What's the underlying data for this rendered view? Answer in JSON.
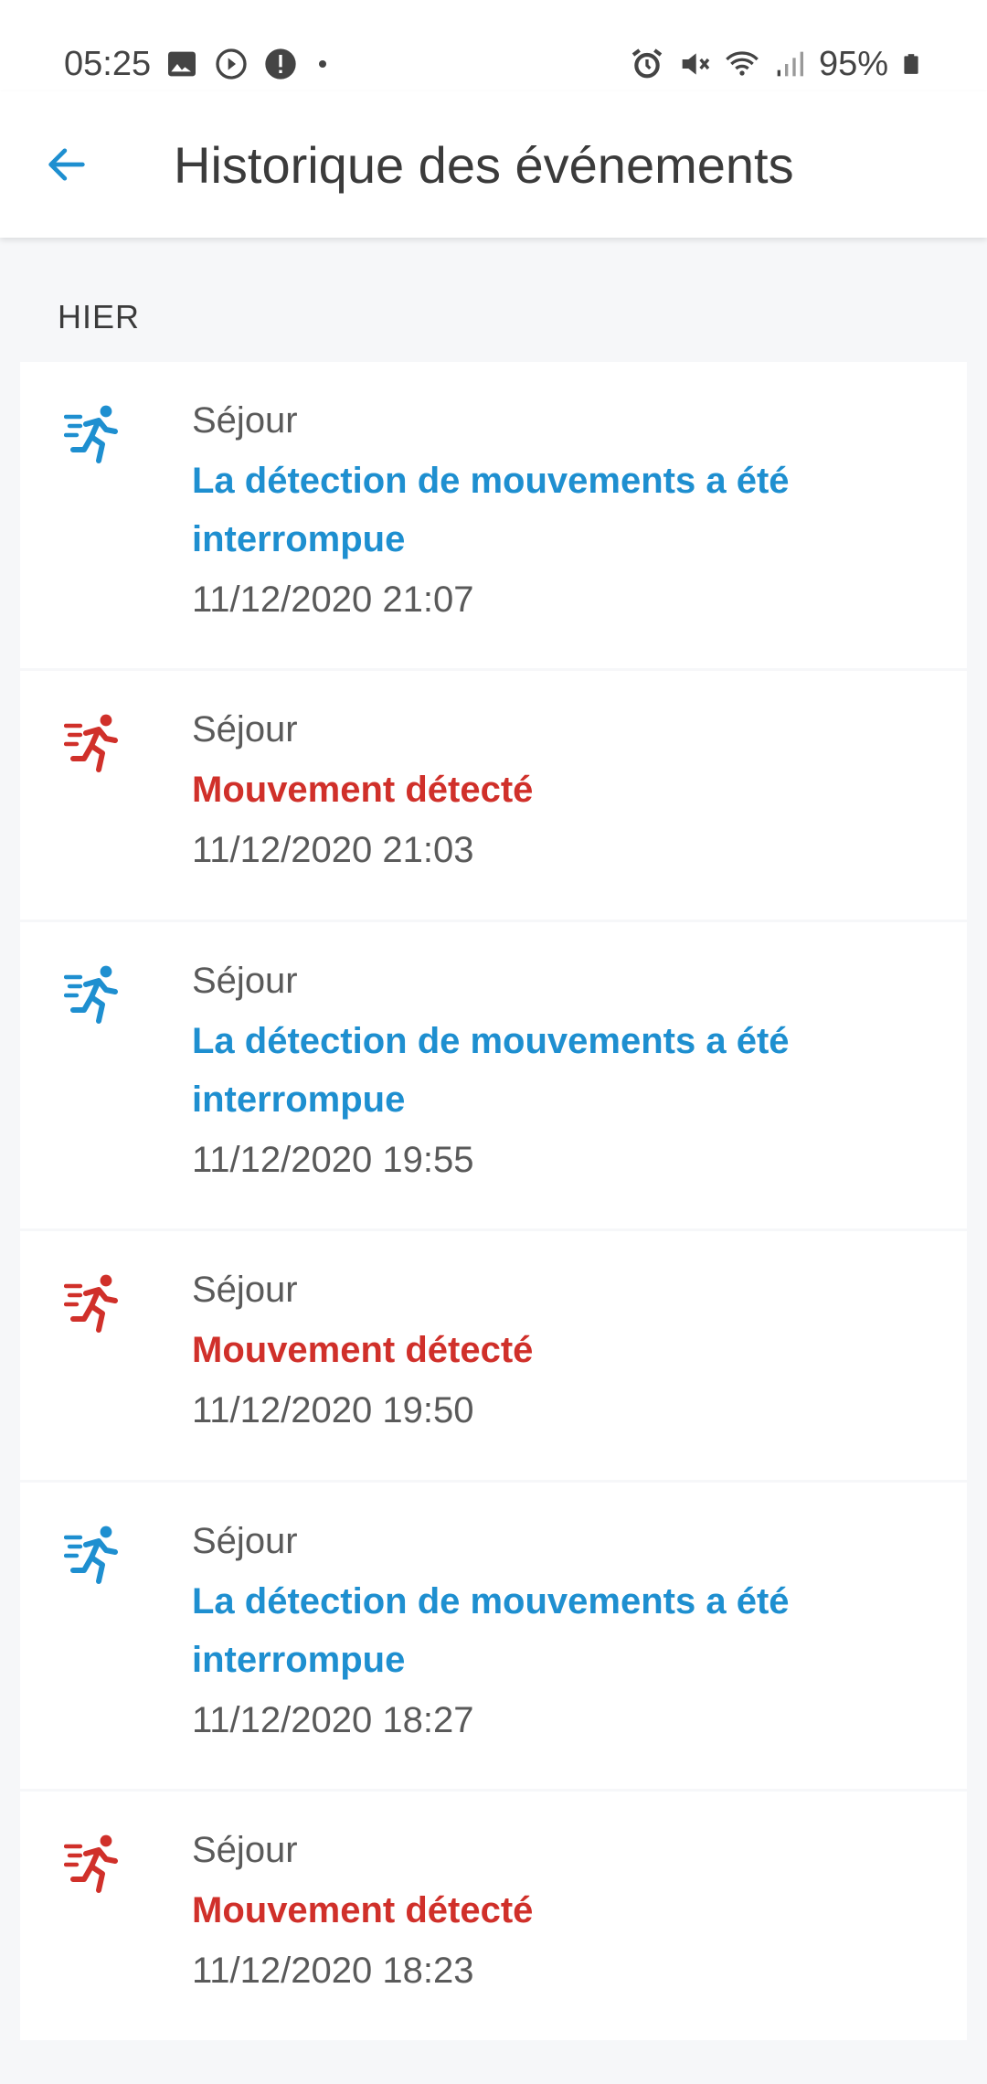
{
  "status_bar": {
    "time": "05:25",
    "battery": "95%"
  },
  "header": {
    "title": "Historique des événements"
  },
  "section": {
    "label": "HIER"
  },
  "colors": {
    "interrupted": "#1e8fd0",
    "detected": "#d0302a"
  },
  "events": [
    {
      "room": "Séjour",
      "message": "La détection de mouvements a été interrompue",
      "time": "11/12/2020 21:07",
      "type": "interrupted",
      "icon": "running-person-icon"
    },
    {
      "room": "Séjour",
      "message": "Mouvement détecté",
      "time": "11/12/2020 21:03",
      "type": "detected",
      "icon": "running-person-icon"
    },
    {
      "room": "Séjour",
      "message": "La détection de mouvements a été interrompue",
      "time": "11/12/2020 19:55",
      "type": "interrupted",
      "icon": "running-person-icon"
    },
    {
      "room": "Séjour",
      "message": "Mouvement détecté",
      "time": "11/12/2020 19:50",
      "type": "detected",
      "icon": "running-person-icon"
    },
    {
      "room": "Séjour",
      "message": "La détection de mouvements a été interrompue",
      "time": "11/12/2020 18:27",
      "type": "interrupted",
      "icon": "running-person-icon"
    },
    {
      "room": "Séjour",
      "message": "Mouvement détecté",
      "time": "11/12/2020 18:23",
      "type": "detected",
      "icon": "running-person-icon"
    }
  ]
}
